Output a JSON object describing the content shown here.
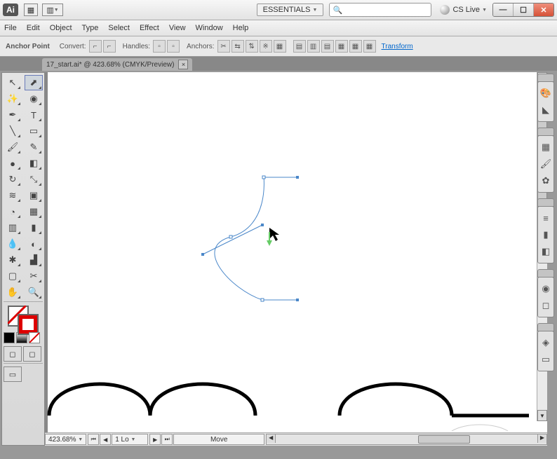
{
  "app": {
    "logo": "Ai"
  },
  "titlebar": {
    "workspace": "ESSENTIALS",
    "search_placeholder": "",
    "cs_live": "CS Live"
  },
  "menubar": {
    "items": [
      "File",
      "Edit",
      "Object",
      "Type",
      "Select",
      "Effect",
      "View",
      "Window",
      "Help"
    ]
  },
  "controlbar": {
    "context_label": "Anchor Point",
    "convert_label": "Convert:",
    "handles_label": "Handles:",
    "anchors_label": "Anchors:",
    "transform_link": "Transform"
  },
  "document": {
    "tab_label": "17_start.ai* @ 423.68% (CMYK/Preview)"
  },
  "status": {
    "zoom": "423.68%",
    "artboard": "1 Lo",
    "tool": "Move"
  },
  "chart_data": null
}
